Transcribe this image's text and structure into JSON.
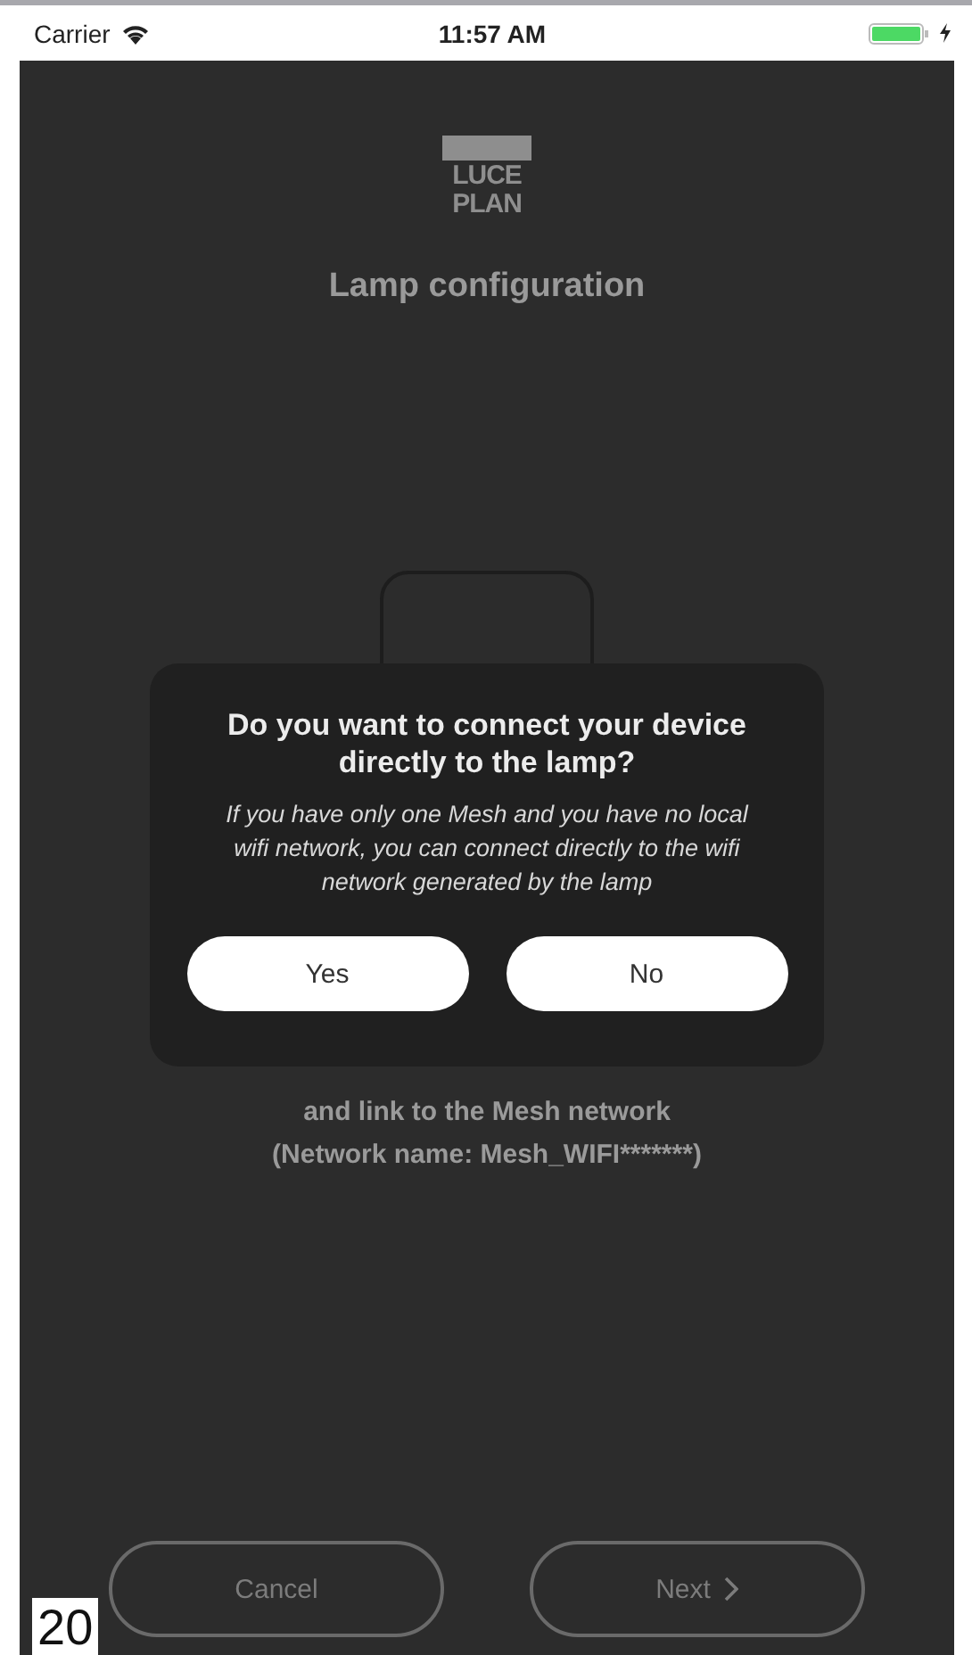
{
  "status_bar": {
    "carrier": "Carrier",
    "time": "11:57 AM"
  },
  "logo": [
    "LUCE",
    "PLAN"
  ],
  "title": "Lamp configuration",
  "instructions": [
    "and link to the Mesh network",
    "(Network name: Mesh_WIFI*******)"
  ],
  "dialog": {
    "title": "Do you want to connect your device directly to the lamp?",
    "message": "If you have only one Mesh and you have no local wifi network, you can connect directly to the wifi network generated by the lamp",
    "buttons": [
      "Yes",
      "No"
    ]
  },
  "footer_buttons": [
    {
      "label": "Cancel",
      "kind": "back"
    },
    {
      "label": "Next",
      "kind": "next"
    }
  ],
  "page_number": "20"
}
